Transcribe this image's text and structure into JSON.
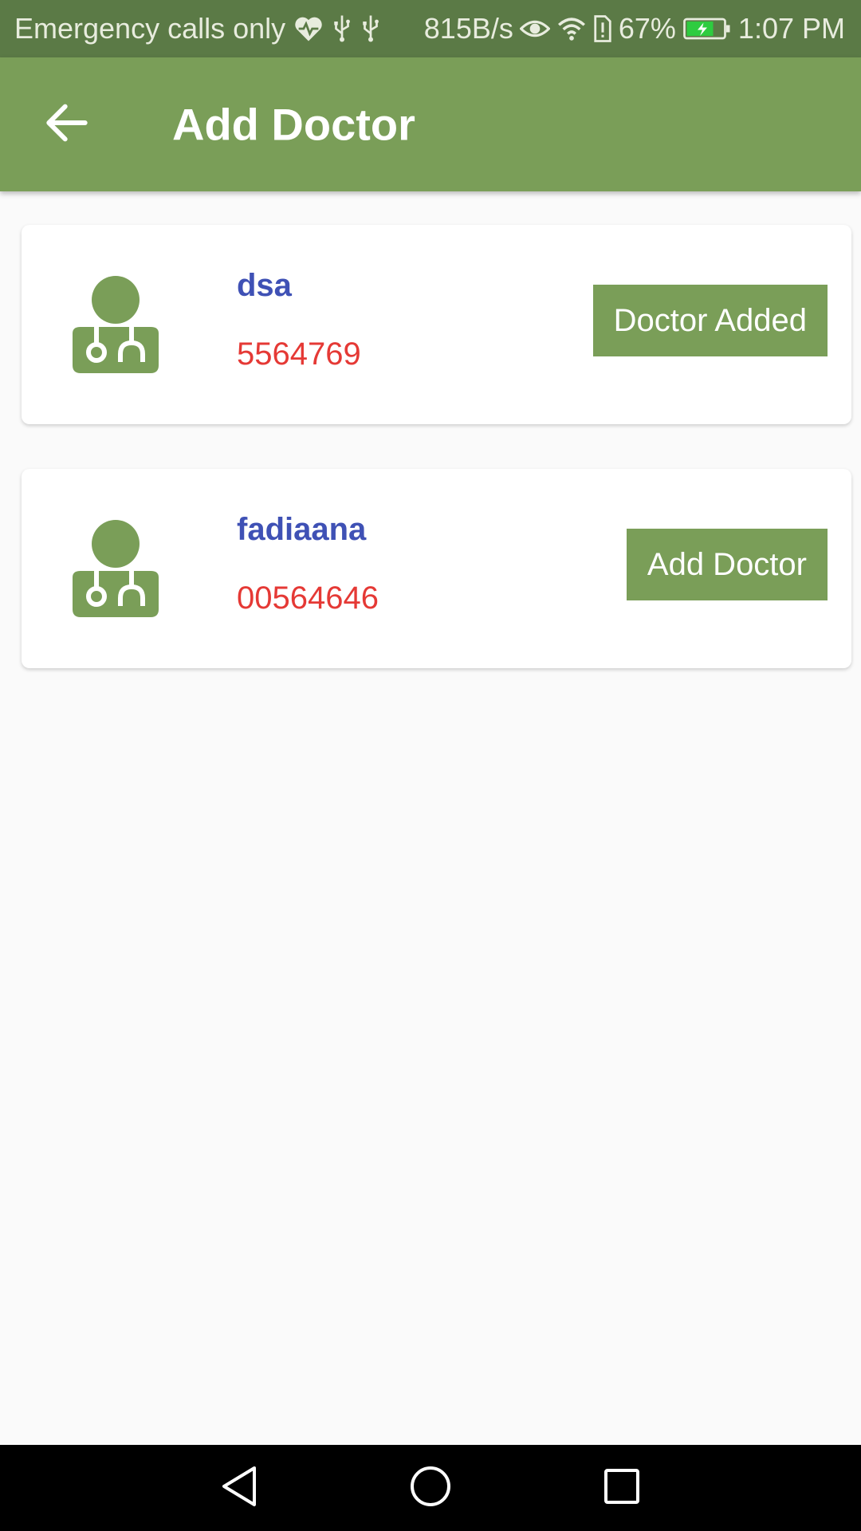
{
  "status_bar": {
    "carrier_text": "Emergency calls only",
    "net_speed": "815B/s",
    "battery_percent": "67%",
    "time": "1:07 PM",
    "icons": [
      "heart-pulse-icon",
      "usb-icon",
      "usb-icon",
      "eye-icon",
      "wifi-icon",
      "sim-alert-icon",
      "battery-charging-icon"
    ]
  },
  "app_bar": {
    "title": "Add Doctor",
    "back_icon": "arrow-left-icon"
  },
  "doctors": [
    {
      "name": "dsa",
      "phone": "5564769",
      "action_label": "Doctor Added",
      "avatar_icon": "doctor-icon"
    },
    {
      "name": "fadiaana",
      "phone": "00564646",
      "action_label": "Add Doctor",
      "avatar_icon": "doctor-icon"
    }
  ],
  "nav_bar": {
    "icons": [
      "back-triangle-icon",
      "home-circle-icon",
      "recents-square-icon"
    ]
  },
  "colors": {
    "status_bar": "#5b7a46",
    "primary": "#7a9e58",
    "name_text": "#3f51b5",
    "phone_text": "#e53935",
    "background": "#fafafa"
  }
}
